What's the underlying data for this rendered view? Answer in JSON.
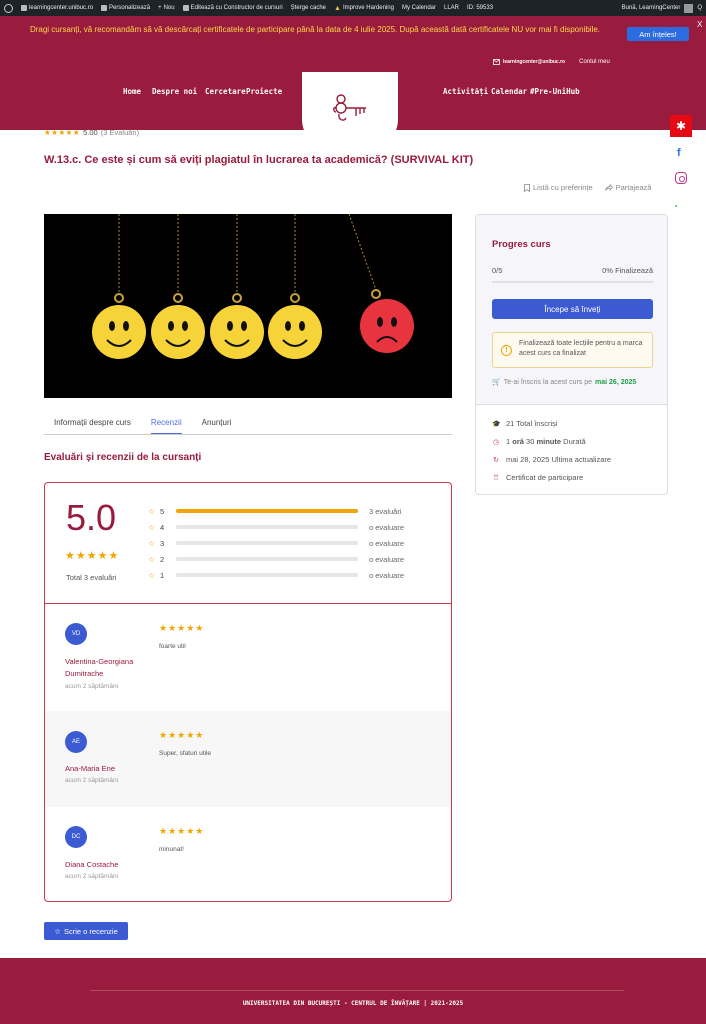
{
  "admin_bar": {
    "items": [
      "learningcenter.unibuc.ro",
      "Personalizează",
      "Nou",
      "Editează cu Constructor de cursuri",
      "Șterge cache",
      "Improve Hardening",
      "My Calendar",
      "LLAR",
      "ID: 59533"
    ],
    "greeting": "Bună, LearningCenter",
    "search_glyph": "Q"
  },
  "notice": {
    "text": "Dragi cursanți, vă recomandăm să vă descărcați certificatele de participare până la data de 4 iulie 2025. După această dată certificatele NU vor mai fi disponibile.",
    "button": "Am înțeles!",
    "close": "X"
  },
  "top_links": {
    "email": "learningcenter@unibuc.ro",
    "account": "Contul meu"
  },
  "nav": {
    "left": [
      "Home",
      "Despre noi",
      "Cercetare",
      "Proiecte"
    ],
    "right": [
      "Activități",
      "Calendar",
      "#Pre-UniHub"
    ]
  },
  "social": {
    "facebook": "f",
    "gear": "✱"
  },
  "course": {
    "stars": "★★★★★",
    "rating": "5.00",
    "rating_count": "(3 Evaluări)",
    "title": "W.13.c. Ce este și cum să eviți plagiatul în lucrarea ta academică? (SURVIVAL KIT)",
    "wishlist": "Listă cu preferințe",
    "share": "Partajează"
  },
  "tabs": [
    "Informații despre curs",
    "Recenzii",
    "Anunțuri"
  ],
  "reviews_section": {
    "title": "Evaluări și recenzii de la cursanți",
    "score": "5.0",
    "stars": "★★★★★",
    "total": "Total 3 evaluări",
    "bars": [
      {
        "star": "5",
        "fraction": 1.0,
        "label": "3 evaluări"
      },
      {
        "star": "4",
        "fraction": 0,
        "label": "o evaluare"
      },
      {
        "star": "3",
        "fraction": 0,
        "label": "o evaluare"
      },
      {
        "star": "2",
        "fraction": 0,
        "label": "o evaluare"
      },
      {
        "star": "1",
        "fraction": 0,
        "label": "o evaluare"
      }
    ],
    "reviews": [
      {
        "initials": "VD",
        "name": "Valentina-Georgiana Dumitrache",
        "ago": "acum 2 săptămâni",
        "stars": "★★★★★",
        "text": "foarte util"
      },
      {
        "initials": "AE",
        "name": "Ana-Maria Ene",
        "ago": "acum 2 săptămâni",
        "stars": "★★★★★",
        "text": "Super, sfaturi utile"
      },
      {
        "initials": "DC",
        "name": "Diana Costache",
        "ago": "acum 2 săptămâni",
        "stars": "★★★★★",
        "text": "minunat!"
      }
    ],
    "write_button": "Scrie o recenzie"
  },
  "progress_card": {
    "title": "Progres curs",
    "done": "0/5",
    "percent": "0% Finalizează",
    "progress_fraction": 0,
    "start_button": "Începe să înveți",
    "alert": "Finalizează toate lecțiile pentru a marca acest curs ca finalizat",
    "enrolled_text": "Te-ai înscris la acest curs pe",
    "enrolled_date": "mai 26, 2025",
    "meta": {
      "enrolled_total": "21 Total înscriși",
      "duration_h": "1",
      "duration_h_unit": "oră",
      "duration_m": "30",
      "duration_m_unit": "minute",
      "duration_label": "Durată",
      "updated": "mai 28, 2025 Ultima actualizare",
      "certificate": "Certificat de participare"
    }
  },
  "footer": {
    "copyright": "UNIVERSITATEA DIN BUCUREȘTI - CENTRUL DE ÎNVĂȚARE | 2021-2025"
  },
  "colors": {
    "brand": "#991b3d",
    "accent": "#3c5ad2",
    "star": "#f0a500",
    "success": "#1e9e4a"
  }
}
